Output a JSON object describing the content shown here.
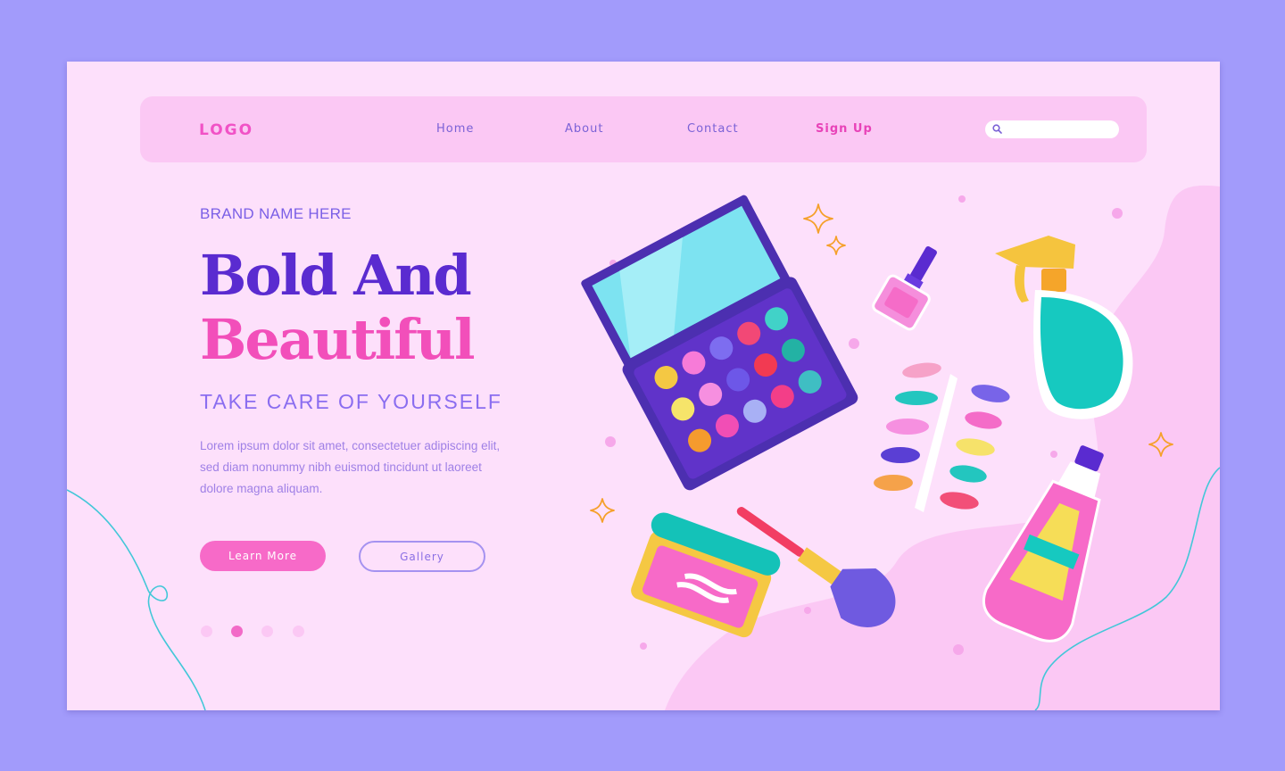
{
  "nav": {
    "logo": "LOGO",
    "links": [
      {
        "label": "Home"
      },
      {
        "label": "About"
      },
      {
        "label": "Contact"
      },
      {
        "label": "Sign Up"
      }
    ],
    "search_placeholder": ""
  },
  "hero": {
    "brand": "BRAND NAME HERE",
    "headline_line1": "Bold And",
    "headline_line2": "Beautiful",
    "tagline": "TAKE CARE OF YOURSELF",
    "body": "Lorem ipsum dolor sit amet, consectetuer adipiscing elit, sed diam nonummy nibh euismod tincidunt ut laoreet dolore magna aliquam.",
    "primary_button": "Learn More",
    "secondary_button": "Gallery"
  },
  "carousel": {
    "count": 4,
    "active_index": 1
  },
  "colors": {
    "frame": "#a29bfb",
    "page_bg": "#fde0fb",
    "navbar_bg": "#fbc8f4",
    "headline_purple": "#5a2bd0",
    "headline_pink": "#f24fba",
    "accent_pink": "#f76ac8",
    "text_purple": "#7a5fe6"
  },
  "illustration_items": [
    "eyeshadow-palette-icon",
    "nail-polish-icon",
    "spray-bottle-icon",
    "nail-tips-icon",
    "makeup-brush-icon",
    "cream-jar-icon",
    "lotion-bottle-icon"
  ]
}
